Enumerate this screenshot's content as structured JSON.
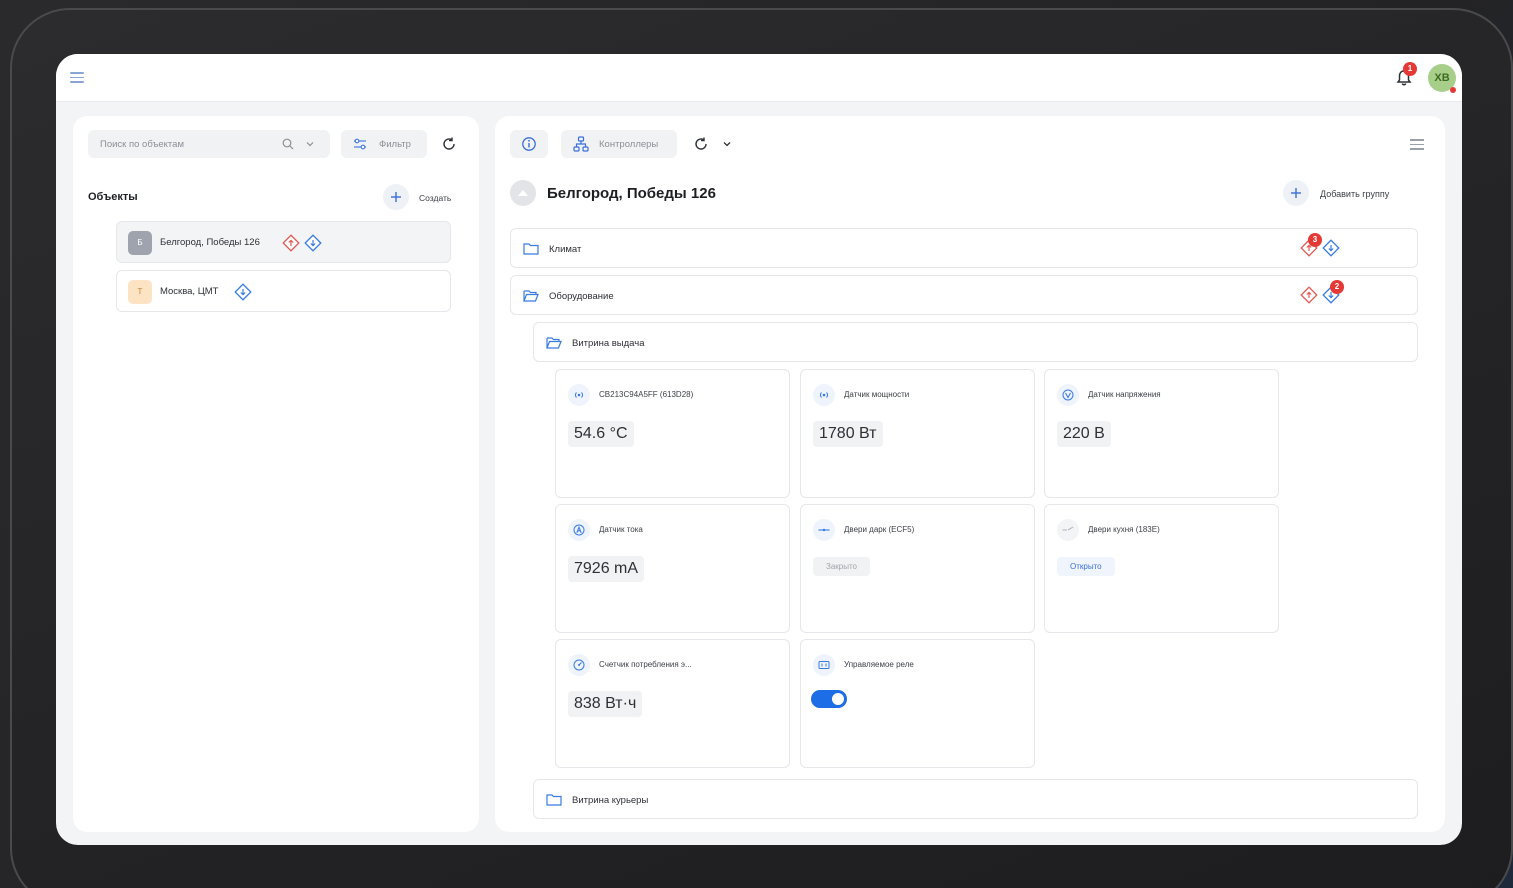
{
  "header": {
    "notifications_count": "1",
    "avatar_initials": "XB"
  },
  "left": {
    "search_placeholder": "Поиск по объектам",
    "filter_label": "Фильтр",
    "objects_title": "Объекты",
    "create_label": "Создать",
    "objects": [
      {
        "label": "Белгород, Победы 126",
        "initial": "Б",
        "color": "#9ea3ad"
      },
      {
        "label": "Москва, ЦМТ",
        "initial": "Т",
        "color": "#f7c98a"
      }
    ]
  },
  "right": {
    "controllers_label": "Контроллеры",
    "location_title": "Белгород, Победы 126",
    "add_group_label": "Добавить группу",
    "folders": {
      "climate": {
        "label": "Климат",
        "badge": "3"
      },
      "equipment": {
        "label": "Оборудование",
        "badge": "2"
      },
      "showcase_issue": {
        "label": "Витрина выдача"
      },
      "showcase_couriers": {
        "label": "Витрина курьеры"
      }
    },
    "devices": [
      {
        "title": "CB213C94A5FF (613D28)",
        "value": "54.6 °C",
        "icon": "signal-icon"
      },
      {
        "title": "Датчик мощности",
        "value": "1780 Вт",
        "icon": "signal-icon"
      },
      {
        "title": "Датчик напряжения",
        "value": "220 В",
        "icon": "voltage-icon"
      },
      {
        "title": "Датчик тока",
        "value": "7926 mA",
        "icon": "current-icon"
      },
      {
        "title": "Двери дарк (ECF5)",
        "status": "Закрыто",
        "icon": "door-closed-icon"
      },
      {
        "title": "Двери кухня (183E)",
        "status": "Открыто",
        "icon": "door-open-icon"
      },
      {
        "title": "Счетчик потребления э...",
        "value": "838 Вт·ч",
        "icon": "meter-icon"
      },
      {
        "title": "Управляемое реле",
        "toggle_on": true,
        "icon": "relay-icon"
      }
    ]
  },
  "colors": {
    "accent": "#1c6de6",
    "danger": "#e53935",
    "avatar_bg": "#a7cf8a"
  }
}
